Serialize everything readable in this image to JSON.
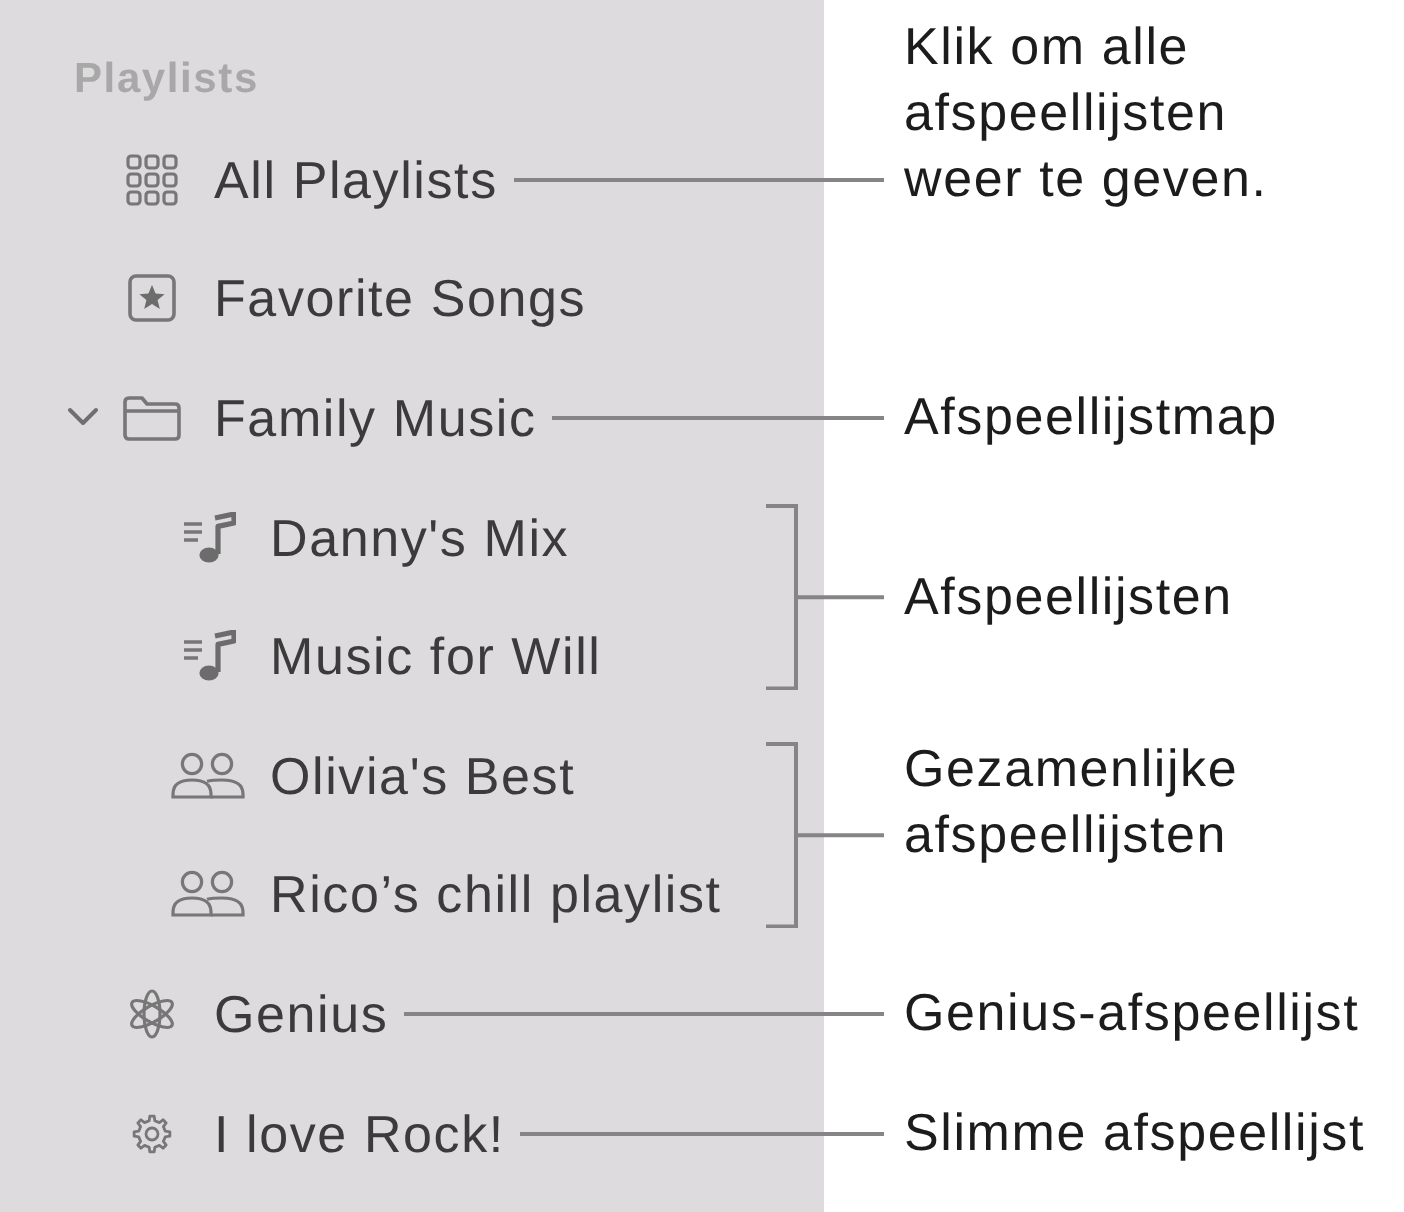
{
  "sidebar": {
    "header": "Playlists",
    "items": [
      {
        "kind": "all",
        "label": "All Playlists",
        "callout": {
          "kind": "line",
          "text": "Klik om alle\nafspeellijsten\nweer te geven."
        }
      },
      {
        "kind": "favorites",
        "label": "Favorite Songs"
      },
      {
        "kind": "folder",
        "label": "Family Music",
        "expanded": true,
        "callout": {
          "kind": "line",
          "text": "Afspeellijstmap"
        },
        "children": [
          {
            "kind": "playlist",
            "label": "Danny's Mix",
            "callout": {
              "kind": "bracket",
              "text": "Afspeellijsten"
            }
          },
          {
            "kind": "playlist",
            "label": "Music for Will"
          },
          {
            "kind": "shared",
            "label": "Olivia's Best",
            "callout": {
              "kind": "bracket",
              "text": "Gezamenlijke\nafspeellijsten"
            }
          },
          {
            "kind": "shared",
            "label": "Rico’s chill playlist"
          }
        ]
      },
      {
        "kind": "genius",
        "label": "Genius",
        "callout": {
          "kind": "line",
          "text": "Genius-afspeellijst"
        }
      },
      {
        "kind": "smart",
        "label": "I love Rock!",
        "callout": {
          "kind": "line",
          "text": "Slimme afspeellijst"
        }
      }
    ]
  }
}
